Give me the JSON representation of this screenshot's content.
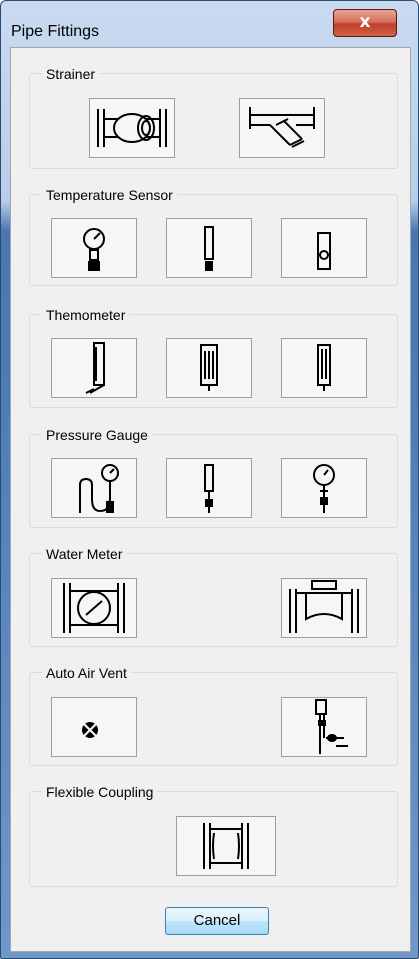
{
  "window": {
    "title": "Pipe Fittings",
    "close_glyph": "x"
  },
  "groups": [
    {
      "label": "Strainer",
      "buttons": [
        "strainer-basket-icon",
        "strainer-y-type-icon"
      ]
    },
    {
      "label": "Temperature Sensor",
      "buttons": [
        "temperature-sensor-dial-icon",
        "temperature-sensor-probe-icon",
        "temperature-sensor-inline-icon"
      ]
    },
    {
      "label": "Themometer",
      "buttons": [
        "thermometer-angled-icon",
        "thermometer-straight-icon",
        "thermometer-column-icon"
      ]
    },
    {
      "label": "Pressure Gauge",
      "buttons": [
        "pressure-gauge-siphon-icon",
        "pressure-gauge-straight-icon",
        "pressure-gauge-dial-icon"
      ]
    },
    {
      "label": "Water Meter",
      "buttons": [
        "water-meter-dial-icon",
        "water-meter-body-icon"
      ]
    },
    {
      "label": "Auto Air Vent",
      "buttons": [
        "air-vent-symbol-icon",
        "air-vent-assembly-icon"
      ]
    },
    {
      "label": "Flexible Coupling",
      "buttons": [
        "flexible-coupling-icon"
      ]
    }
  ],
  "footer": {
    "cancel_label": "Cancel"
  },
  "colors": {
    "title_bar": "#c9daf0",
    "close_button": "#c0412a",
    "dialog_bg": "#f0f0f0"
  }
}
